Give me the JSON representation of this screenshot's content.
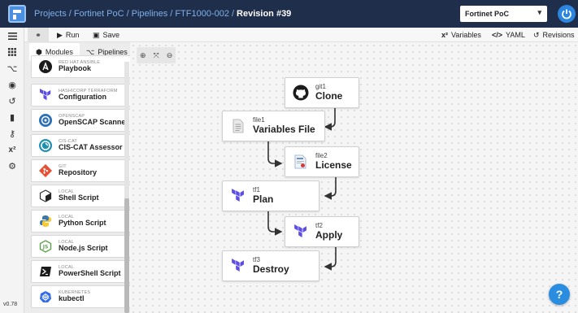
{
  "breadcrumb": {
    "projects": "Projects",
    "tenant": "Fortinet PoC",
    "pipelines": "Pipelines",
    "pipeline": "FTF1000-002",
    "revision": "Revision #39"
  },
  "tenant_select": {
    "value": "Fortinet PoC"
  },
  "version": "v0.78",
  "toolbar": {
    "run": "Run",
    "save": "Save",
    "variables": "Variables",
    "yaml": "YAML",
    "revisions": "Revisions"
  },
  "palette": {
    "tabs": {
      "modules": "Modules",
      "pipelines": "Pipelines"
    },
    "items": [
      {
        "category": "RED HAT ANSIBLE",
        "name": "Playbook",
        "icon": "ansible-icon"
      },
      {
        "category": "HASHICORP TERRAFORM",
        "name": "Configuration",
        "icon": "terraform-icon"
      },
      {
        "category": "OPENSCAP",
        "name": "OpenSCAP Scanner",
        "icon": "openscap-icon"
      },
      {
        "category": "CIS-CAT",
        "name": "CIS-CAT Assessor",
        "icon": "ciscat-icon"
      },
      {
        "category": "GIT",
        "name": "Repository",
        "icon": "git-icon"
      },
      {
        "category": "LOCAL",
        "name": "Shell Script",
        "icon": "shell-icon"
      },
      {
        "category": "LOCAL",
        "name": "Python Script",
        "icon": "python-icon"
      },
      {
        "category": "LOCAL",
        "name": "Node.js Script",
        "icon": "nodejs-icon"
      },
      {
        "category": "LOCAL",
        "name": "PowerShell Script",
        "icon": "powershell-icon"
      },
      {
        "category": "KUBERNETES",
        "name": "kubectl",
        "icon": "kubernetes-icon"
      }
    ]
  },
  "nodes": [
    {
      "id": "git1",
      "label": "Clone",
      "icon": "github-icon"
    },
    {
      "id": "file1",
      "label": "Variables File",
      "icon": "file-icon"
    },
    {
      "id": "file2",
      "label": "License",
      "icon": "license-file-icon"
    },
    {
      "id": "tf1",
      "label": "Plan",
      "icon": "terraform-icon"
    },
    {
      "id": "tf2",
      "label": "Apply",
      "icon": "terraform-icon"
    },
    {
      "id": "tf3",
      "label": "Destroy",
      "icon": "terraform-icon"
    }
  ],
  "help": "?",
  "colors": {
    "topbar": "#1f2e4a",
    "breadcrumb_link": "#7fb0ea",
    "accent": "#2b8de0",
    "terraform": "#5c4ee5"
  }
}
